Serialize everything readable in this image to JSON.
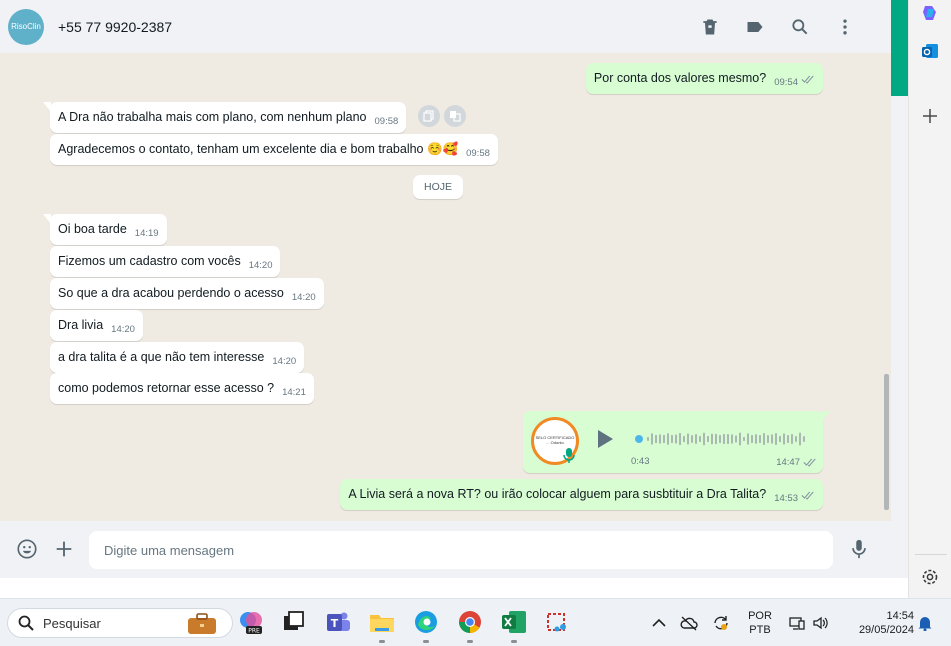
{
  "header": {
    "avatar_text": "RisoClin",
    "contact": "+55 77 9920-2387",
    "icons": [
      "trash-icon",
      "label-icon",
      "search-icon",
      "more-icon"
    ]
  },
  "messages": [
    {
      "dir": "out",
      "text": "Por conta dos valores mesmo?",
      "time": "09:54"
    },
    {
      "dir": "in",
      "text": "A Dra não trabalha mais com plano, com nenhum plano",
      "time": "09:58"
    },
    {
      "dir": "in",
      "text": "Agradecemos o contato, tenham um excelente dia e bom trabalho ☺️🥰",
      "time": "09:58"
    },
    {
      "dir": "in",
      "text": "Oi boa tarde",
      "time": "14:19"
    },
    {
      "dir": "in",
      "text": "Fizemos um cadastro com vocês",
      "time": "14:20"
    },
    {
      "dir": "in",
      "text": "So que a dra acabou perdendo o acesso",
      "time": "14:20"
    },
    {
      "dir": "in",
      "text": "Dra livia",
      "time": "14:20"
    },
    {
      "dir": "in",
      "text": "a dra talita é a que não tem interesse",
      "time": "14:20"
    },
    {
      "dir": "in",
      "text": "como podemos retornar esse acesso ?",
      "time": "14:21"
    },
    {
      "dir": "out",
      "text": "A Livia será a nova RT? ou irão colocar alguem para susbtituir a Dra Talita?",
      "time": "14:53"
    }
  ],
  "date_divider": "HOJE",
  "audio": {
    "duration": "0:43",
    "time": "14:47",
    "thumb_text": "SELO CERTIFICADO ... Odonto"
  },
  "composer": {
    "placeholder": "Digite uma mensagem"
  },
  "colors": {
    "outgoing_bubble": "#d9fdd3",
    "incoming_bubble": "#ffffff",
    "chat_bg": "#efeae2",
    "accent": "#00a884"
  },
  "taskbar": {
    "search_label": "Pesquisar",
    "lang_top": "POR",
    "lang_bottom": "PTB",
    "clock_time": "14:54",
    "clock_date": "29/05/2024"
  }
}
